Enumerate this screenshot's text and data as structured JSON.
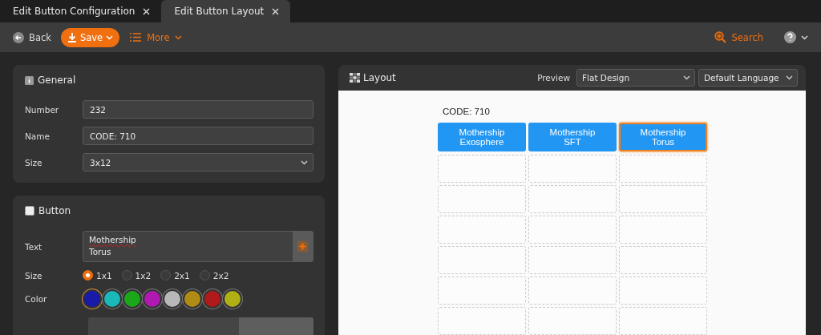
{
  "tabs": [
    {
      "label": "Edit Button Configuration",
      "selected": false
    },
    {
      "label": "Edit Button Layout",
      "selected": true
    }
  ],
  "toolbar": {
    "back": "Back",
    "save": "Save",
    "more": "More",
    "search": "Search"
  },
  "general": {
    "title": "General",
    "fields": [
      {
        "label": "Number",
        "kind": "text",
        "value": "232"
      },
      {
        "label": "Name",
        "kind": "text",
        "value": "CODE: 710"
      },
      {
        "label": "Size",
        "kind": "select",
        "value": "3x12"
      }
    ]
  },
  "button": {
    "title": "Button",
    "checked": false,
    "text_label": "Text",
    "text_lines": [
      "Mothership",
      "Torus"
    ],
    "size_label": "Size",
    "sizes": [
      {
        "label": "1x1",
        "selected": true
      },
      {
        "label": "1x2",
        "selected": false
      },
      {
        "label": "2x1",
        "selected": false
      },
      {
        "label": "2x2",
        "selected": false
      }
    ],
    "color_label": "Color",
    "colors": [
      {
        "color": "#1a1aa8",
        "selected": true
      },
      {
        "color": "#1ab8b8",
        "selected": false
      },
      {
        "color": "#1aa81a",
        "selected": false
      },
      {
        "color": "#b01ab0",
        "selected": false
      },
      {
        "color": "#b8b8b8",
        "selected": false
      },
      {
        "color": "#b08c14",
        "selected": false
      },
      {
        "color": "#b01a1a",
        "selected": false
      },
      {
        "color": "#b0b014",
        "selected": false
      }
    ]
  },
  "layout": {
    "title": "Layout",
    "preview_label": "Preview",
    "preview": "Flat Design",
    "language": "Default Language",
    "canvas_title": "CODE: 710",
    "rows": [
      [
        {
          "kind": "button",
          "label": "Mothership\nExosphere",
          "selected": false
        },
        {
          "kind": "button",
          "label": "Mothership\nSFT",
          "selected": false
        },
        {
          "kind": "button",
          "label": "Mothership\nTorus",
          "selected": true
        }
      ],
      [
        {
          "kind": "empty"
        },
        {
          "kind": "empty"
        },
        {
          "kind": "empty"
        }
      ],
      [
        {
          "kind": "empty"
        },
        {
          "kind": "empty"
        },
        {
          "kind": "empty"
        }
      ],
      [
        {
          "kind": "empty"
        },
        {
          "kind": "empty"
        },
        {
          "kind": "empty"
        }
      ],
      [
        {
          "kind": "empty"
        },
        {
          "kind": "empty"
        },
        {
          "kind": "empty"
        }
      ],
      [
        {
          "kind": "empty"
        },
        {
          "kind": "empty"
        },
        {
          "kind": "empty"
        }
      ],
      [
        {
          "kind": "empty"
        },
        {
          "kind": "empty"
        },
        {
          "kind": "empty"
        }
      ]
    ]
  }
}
